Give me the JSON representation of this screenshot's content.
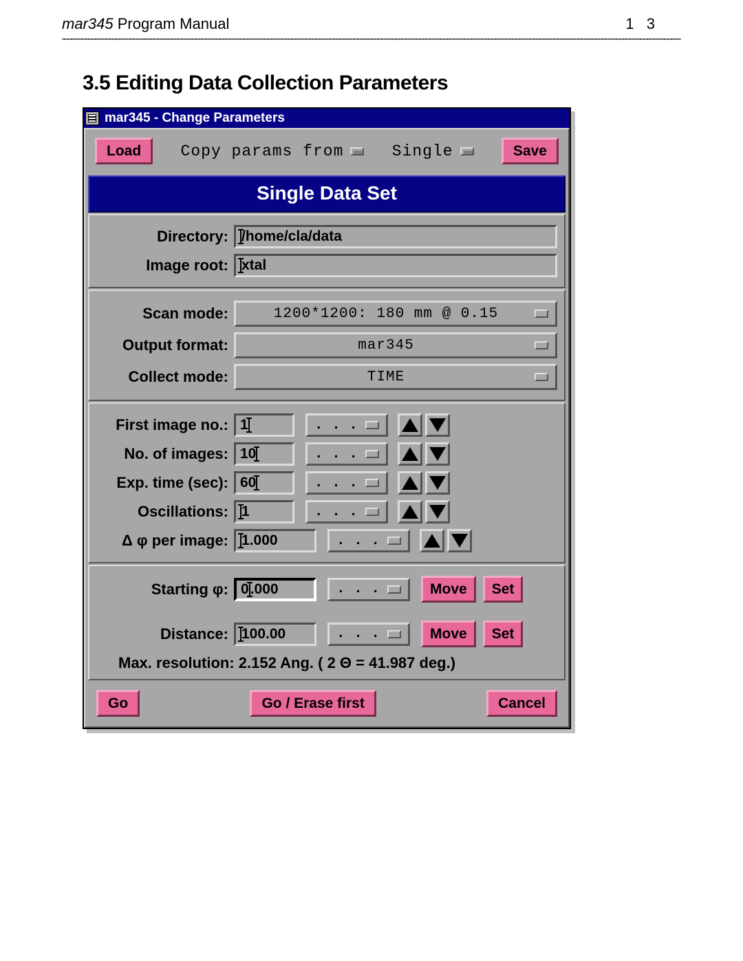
{
  "page": {
    "program_name_italic": "mar345",
    "program_manual": " Program Manual",
    "page_number": "1 3",
    "section_title": "3.5 Editing Data Collection Parameters"
  },
  "window": {
    "title": "mar345 - Change Parameters"
  },
  "toolbar": {
    "load": "Load",
    "copy_params_from": "Copy params from",
    "mode_option": "Single",
    "save": "Save"
  },
  "banner": "Single Data Set",
  "paths": {
    "dir_label": "Directory:",
    "dir_value": "/home/cla/data",
    "root_label": "Image root:",
    "root_value": "xtal"
  },
  "modes": {
    "scan_label": "Scan mode:",
    "scan_value": "1200*1200:  180 mm @ 0.15",
    "outfmt_label": "Output format:",
    "outfmt_value": "mar345",
    "collect_label": "Collect mode:",
    "collect_value": "TIME"
  },
  "counts": {
    "first_label": "First image no.:",
    "first_value": "1",
    "noimg_label": "No. of images:",
    "noimg_value": "10",
    "exp_label": "Exp. time (sec):",
    "exp_value": "60",
    "osc_label": "Oscillations:",
    "osc_value": "1",
    "dphi_label": "Δ φ per image:",
    "dphi_value": "1.000",
    "dots": ". . .",
    "dots2": ". . .",
    "dots3": ". . .",
    "dots4": ". . .",
    "dots5": ". . ."
  },
  "geom": {
    "startphi_label": "Starting φ:",
    "startphi_value": "0.000",
    "dist_label": "Distance:",
    "dist_value": "100.00",
    "dots1": ". . .",
    "dots2": ". . .",
    "res_label": "Max. resolution: 2.152 Ang.  ( 2 Θ = 41.987  deg.)",
    "move": "Move",
    "set": "Set"
  },
  "bottom": {
    "go": "Go",
    "go_erase": "Go / Erase first",
    "cancel": "Cancel"
  }
}
